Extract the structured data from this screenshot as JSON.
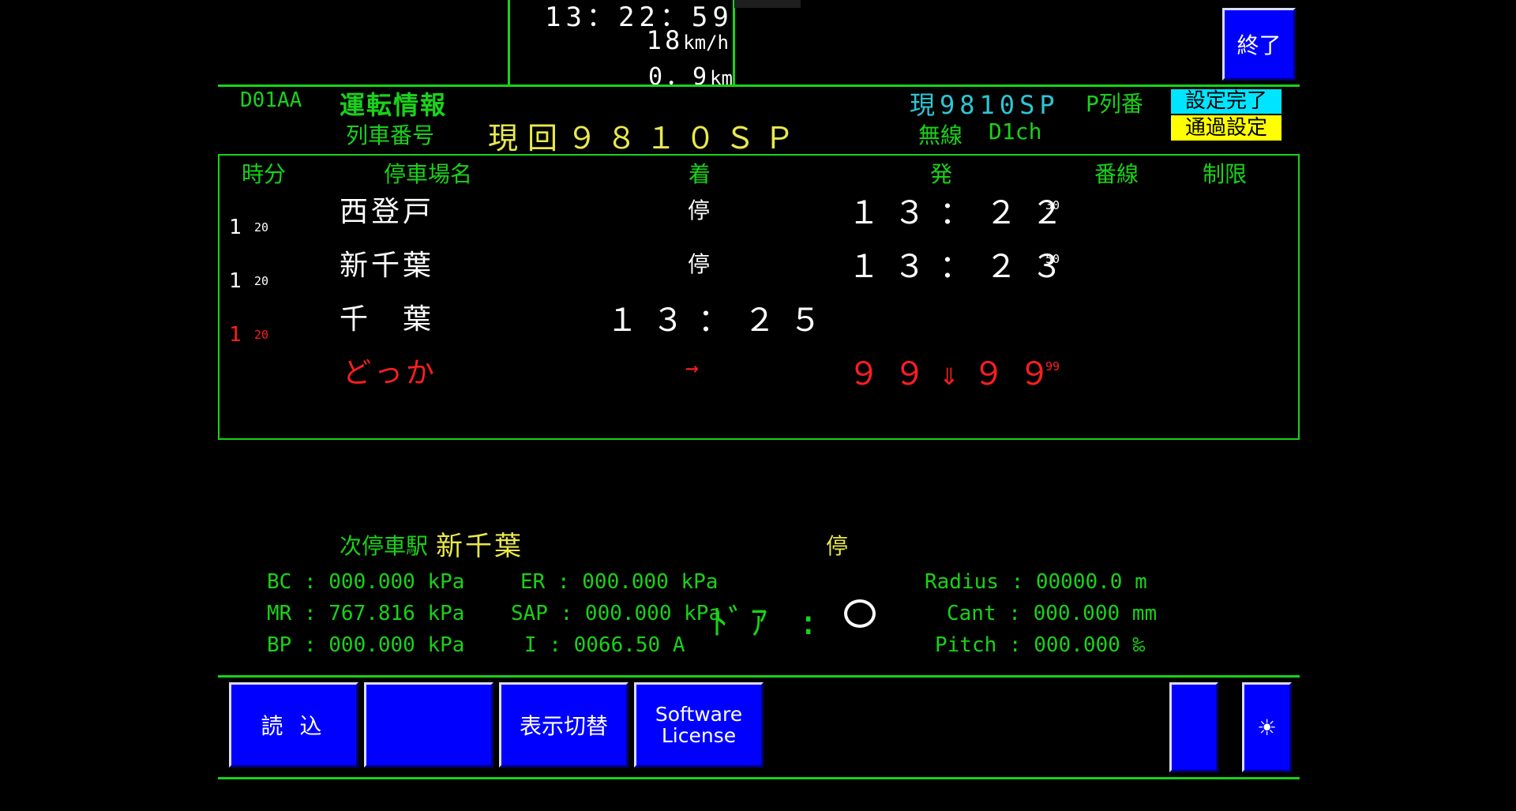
{
  "colors": {
    "background": "#000000",
    "accent_green": "#19d219",
    "cyan": "#2dc6d6",
    "yellow": "#e9e94a",
    "red": "#ff1e1e",
    "button_blue": "#0000ff",
    "badge_cyan": "#00e5ff",
    "badge_yellow": "#ffff00"
  },
  "top": {
    "time": "13：22：59",
    "speed_value": "18",
    "speed_unit": "km/h",
    "distance_value": "0．9",
    "distance_unit": "km",
    "exit_button": "終了"
  },
  "info": {
    "id": "D01AA",
    "title": "運転情報",
    "train_no_label": "列車番号",
    "train_no_value": "現回９８１０ＳＰ",
    "current_train": "現9810SP",
    "p_train_no": "P列番",
    "radio_label": "無線",
    "radio_channel": "D1ch",
    "badge_set_complete": "設定完了",
    "badge_pass_setting": "通過設定"
  },
  "table": {
    "headers": {
      "time": "時分",
      "station": "停車場名",
      "arrive": "着",
      "depart": "発",
      "track": "番線",
      "limit": "制限"
    },
    "rows": [
      {
        "station": "西登戸",
        "arrive": "停",
        "depart": "１３：２２",
        "depart_sec": "30"
      },
      {
        "station": "新千葉",
        "arrive": "停",
        "depart": "１３：２３",
        "depart_sec": "50"
      },
      {
        "station": "千　葉",
        "arrive": "１３：２５",
        "depart": "",
        "depart_sec": ""
      },
      {
        "station": "どっか",
        "arrive": "→",
        "depart": "９９⇓９９",
        "depart_sec": "99"
      }
    ],
    "intervals": [
      {
        "min": "1",
        "sec": "20"
      },
      {
        "min": "1",
        "sec": "20"
      },
      {
        "min": "1",
        "sec": "20"
      }
    ]
  },
  "next_stop": {
    "label": "次停車駅",
    "station": "新千葉",
    "type": "停"
  },
  "stats": {
    "bc": "BC : 000.000 kPa",
    "mr": "MR : 767.816 kPa",
    "bp": "BP : 000.000 kPa",
    "er": "ER : 000.000 kPa",
    "sap": "SAP : 000.000 kPa",
    "current": "I : 0066.50 A",
    "door_label": "ﾄﾞｱ :",
    "radius": "Radius : 00000.0 m",
    "cant": "Cant : 000.000 mm",
    "pitch": "Pitch : 000.000 ‰"
  },
  "buttons": {
    "read": "読 込",
    "blank": "",
    "display_switch": "表示切替",
    "license_line1": "Software",
    "license_line2": "License",
    "blank_small": "",
    "brightness": "☀"
  }
}
